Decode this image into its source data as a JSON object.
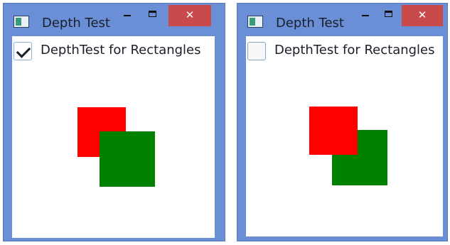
{
  "colors": {
    "frame": "#6a8fd6",
    "close_button": "#c94a4a",
    "red_rect": "#ff0000",
    "green_rect": "#008000"
  },
  "windows": [
    {
      "title": "Depth Test",
      "icon": "app-window-icon",
      "close_label": "✕",
      "checkbox": {
        "label": "DepthTest for Rectangles",
        "checked": true
      },
      "draw_order": [
        "red-rectangle",
        "green-rectangle"
      ]
    },
    {
      "title": "Depth Test",
      "icon": "app-window-icon",
      "close_label": "✕",
      "checkbox": {
        "label": "DepthTest for Rectangles",
        "checked": false
      },
      "draw_order": [
        "green-rectangle",
        "red-rectangle"
      ]
    }
  ]
}
